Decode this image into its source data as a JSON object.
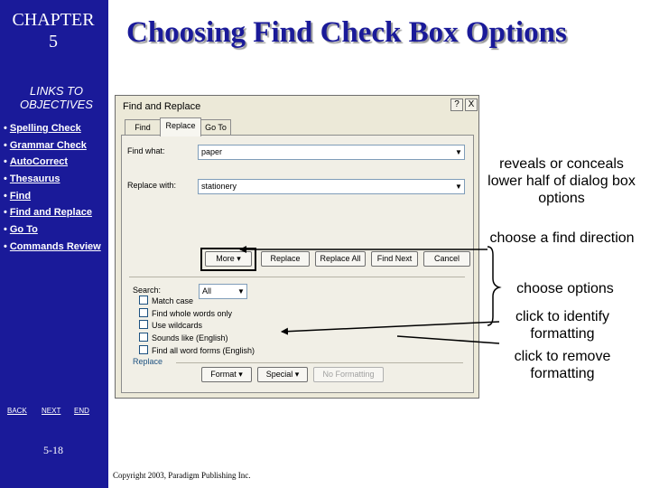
{
  "slide": {
    "chapter_label": "CHAPTER",
    "chapter_number": "5",
    "title": "Choosing Find Check Box Options",
    "page_number": "5-18",
    "copyright": "Copyright 2003, Paradigm Publishing Inc."
  },
  "sidebar": {
    "links_title_line1": "LINKS TO",
    "links_title_line2": "OBJECTIVES",
    "bullet": "•",
    "links": [
      {
        "label": "Spelling Check"
      },
      {
        "label": "Grammar Check"
      },
      {
        "label": "AutoCorrect"
      },
      {
        "label": "Thesaurus"
      },
      {
        "label": "Find"
      },
      {
        "label": "Find and Replace"
      },
      {
        "label": "Go To"
      },
      {
        "label": "Commands Review"
      }
    ],
    "nav": {
      "back": "BACK",
      "next": "NEXT",
      "end": "END"
    }
  },
  "dialog": {
    "title": "Find and Replace",
    "help_glyph": "?",
    "close_glyph": "X",
    "tabs": [
      {
        "label": "Find"
      },
      {
        "label": "Replace"
      },
      {
        "label": "Go To"
      }
    ],
    "find_what_label": "Find what:",
    "find_what_value": "paper",
    "replace_with_label": "Replace with:",
    "replace_with_value": "stationery",
    "buttons": {
      "more": "More ▾",
      "replace": "Replace",
      "replace_all": "Replace All",
      "find_next": "Find Next",
      "cancel": "Cancel",
      "format": "Format ▾",
      "special": "Special ▾",
      "no_formatting": "No Formatting"
    },
    "search_label": "Search:",
    "search_value": "All",
    "options": [
      {
        "label": "Match case"
      },
      {
        "label": "Find whole words only"
      },
      {
        "label": "Use wildcards"
      },
      {
        "label": "Sounds like (English)"
      },
      {
        "label": "Find all word forms (English)"
      }
    ],
    "replace_section_label": "Replace"
  },
  "annotations": {
    "reveal": "reveals or conceals lower half of dialog box options",
    "direction": "choose a find direction",
    "options": "choose options",
    "format": "click to identify formatting",
    "no_format": "click to remove formatting"
  },
  "colors": {
    "sidebar_bg": "#1a1a99",
    "title_text": "#1a1a99",
    "dialog_bg": "#ece9d8"
  }
}
